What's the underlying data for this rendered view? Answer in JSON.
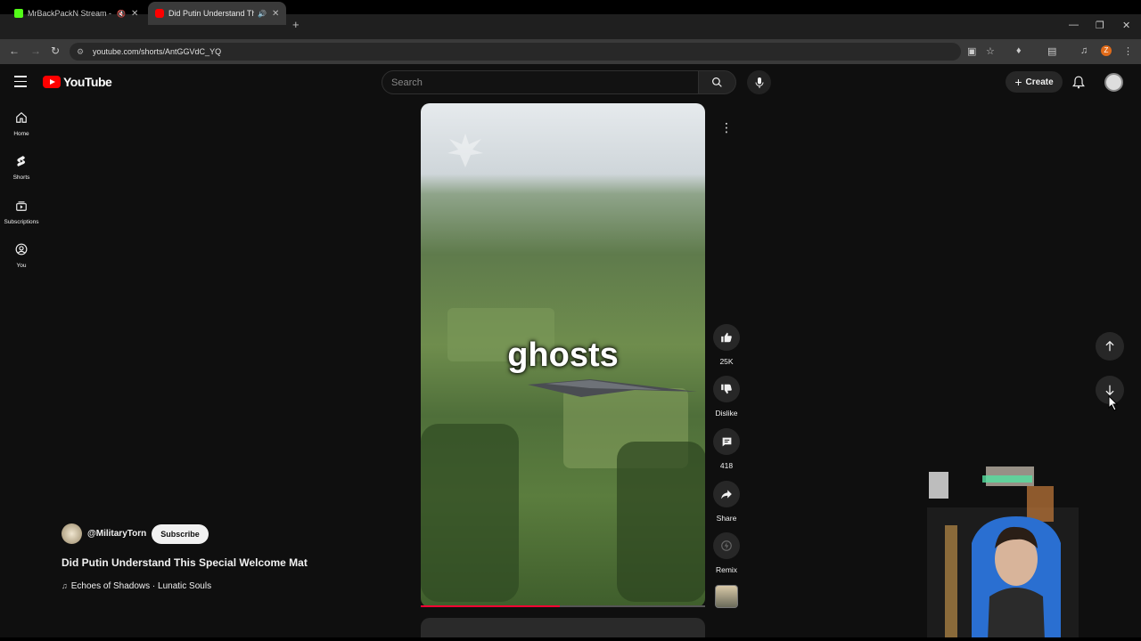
{
  "browser": {
    "tabs": [
      {
        "title": "MrBackPackN Stream - Wat",
        "favicon_color": "#53fc18"
      },
      {
        "title": "Did Putin Understand This",
        "favicon_color": "#ff0000"
      }
    ],
    "url": "youtube.com/shorts/AntGGVdC_YQ",
    "profile_initial": "Z"
  },
  "header": {
    "logo_text": "YouTube",
    "search_placeholder": "Search",
    "create_label": "Create"
  },
  "sidebar": {
    "items": [
      {
        "label": "Home",
        "icon": "home-icon"
      },
      {
        "label": "Shorts",
        "icon": "shorts-icon"
      },
      {
        "label": "Subscriptions",
        "icon": "subscriptions-icon"
      },
      {
        "label": "You",
        "icon": "you-icon"
      }
    ]
  },
  "short": {
    "caption": "ghosts",
    "progress_fraction": 0.49,
    "channel": "@MilitaryTorn",
    "subscribe_label": "Subscribe",
    "title": "Did Putin Understand This Special Welcome Mat",
    "music": "Echoes of Shadows · Lunatic Souls"
  },
  "actions": {
    "like_count": "25K",
    "dislike_label": "Dislike",
    "comment_count": "418",
    "share_label": "Share",
    "remix_label": "Remix"
  },
  "colors": {
    "accent": "#ff0000",
    "progress": "#ff0033",
    "background": "#0f0f0f"
  }
}
